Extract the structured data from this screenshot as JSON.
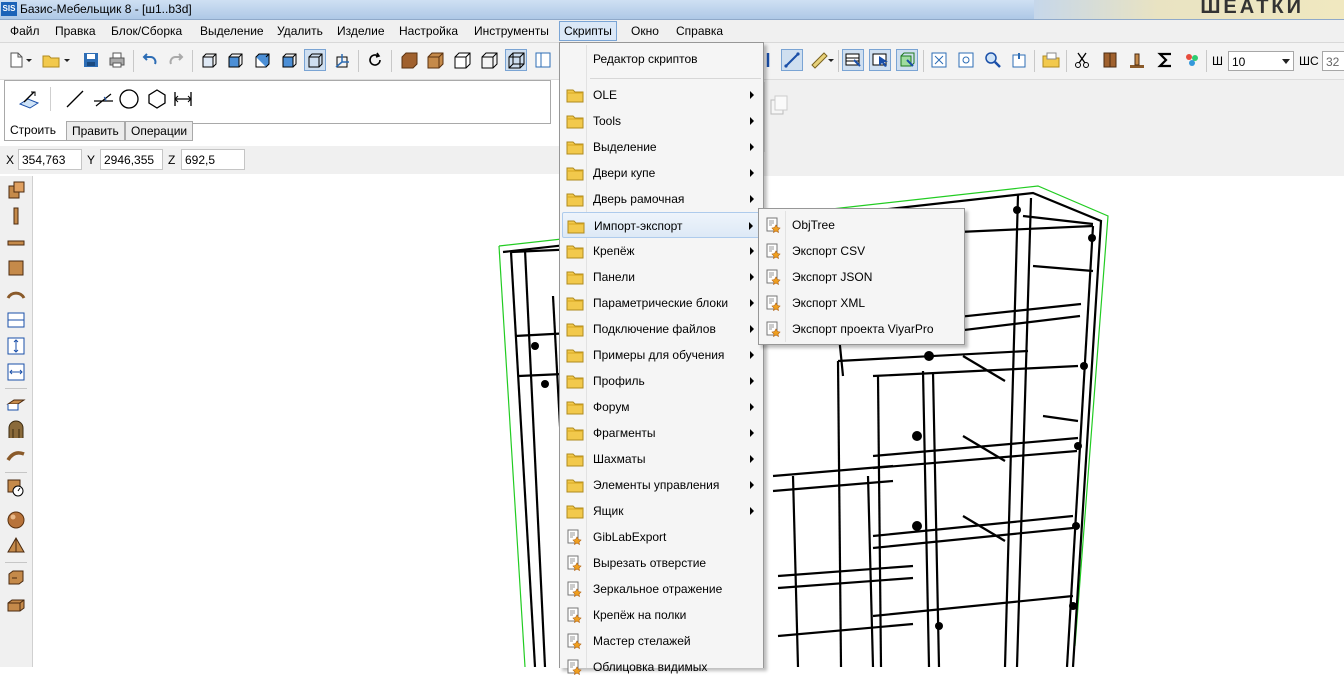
{
  "window": {
    "icon_text": "SIS",
    "title": "Базис-Мебельщик 8 - [ш1..b3d]",
    "decor_text": "ШЕАТКИ"
  },
  "menubar": [
    {
      "label": "Файл"
    },
    {
      "label": "Правка"
    },
    {
      "label": "Блок/Сборка"
    },
    {
      "label": "Выделение"
    },
    {
      "label": "Удалить"
    },
    {
      "label": "Изделие"
    },
    {
      "label": "Настройка"
    },
    {
      "label": "Инструменты"
    },
    {
      "label": "Скрипты"
    },
    {
      "label": "Окно"
    },
    {
      "label": "Справка"
    }
  ],
  "toolbar": {
    "width_label": "Ш",
    "width_value": "10",
    "ws_label": "ШС",
    "ws_value": "32"
  },
  "draw_tabs": [
    {
      "label": "Строить"
    },
    {
      "label": "Править"
    },
    {
      "label": "Операции"
    }
  ],
  "coords": {
    "x_label": "X",
    "x_value": "354,763",
    "y_label": "Y",
    "y_value": "2946,355",
    "z_label": "Z",
    "z_value": "692,5"
  },
  "scripts_menu": {
    "editor": "Редактор скриптов",
    "items": [
      {
        "label": "OLE",
        "type": "folder"
      },
      {
        "label": "Tools",
        "type": "folder"
      },
      {
        "label": "Выделение",
        "type": "folder"
      },
      {
        "label": "Двери купе",
        "type": "folder"
      },
      {
        "label": "Дверь рамочная",
        "type": "folder"
      },
      {
        "label": "Импорт-экспорт",
        "type": "folder",
        "highlighted": true
      },
      {
        "label": "Крепёж",
        "type": "folder"
      },
      {
        "label": "Панели",
        "type": "folder"
      },
      {
        "label": "Параметрические блоки",
        "type": "folder"
      },
      {
        "label": "Подключение файлов",
        "type": "folder"
      },
      {
        "label": "Примеры для обучения",
        "type": "folder"
      },
      {
        "label": "Профиль",
        "type": "folder"
      },
      {
        "label": "Форум",
        "type": "folder"
      },
      {
        "label": "Фрагменты",
        "type": "folder"
      },
      {
        "label": "Шахматы",
        "type": "folder"
      },
      {
        "label": "Элементы управления",
        "type": "folder"
      },
      {
        "label": "Ящик",
        "type": "folder"
      },
      {
        "label": "GibLabExport",
        "type": "script"
      },
      {
        "label": "Вырезать отверстие",
        "type": "script"
      },
      {
        "label": "Зеркальное отражение",
        "type": "script"
      },
      {
        "label": "Крепёж на полки",
        "type": "script"
      },
      {
        "label": "Мастер стелажей",
        "type": "script"
      },
      {
        "label": "Облицовка видимых",
        "type": "script"
      }
    ]
  },
  "import_export_submenu": {
    "items": [
      {
        "label": "ObjTree"
      },
      {
        "label": "Экспорт CSV"
      },
      {
        "label": "Экспорт JSON"
      },
      {
        "label": "Экспорт XML"
      },
      {
        "label": "Экспорт проекта ViyarPro"
      }
    ]
  },
  "colors": {
    "menu_highlight": "#dde9f6",
    "folder": "#f2c94c",
    "bbox_green": "#22cc22",
    "wireframe": "#000000"
  }
}
